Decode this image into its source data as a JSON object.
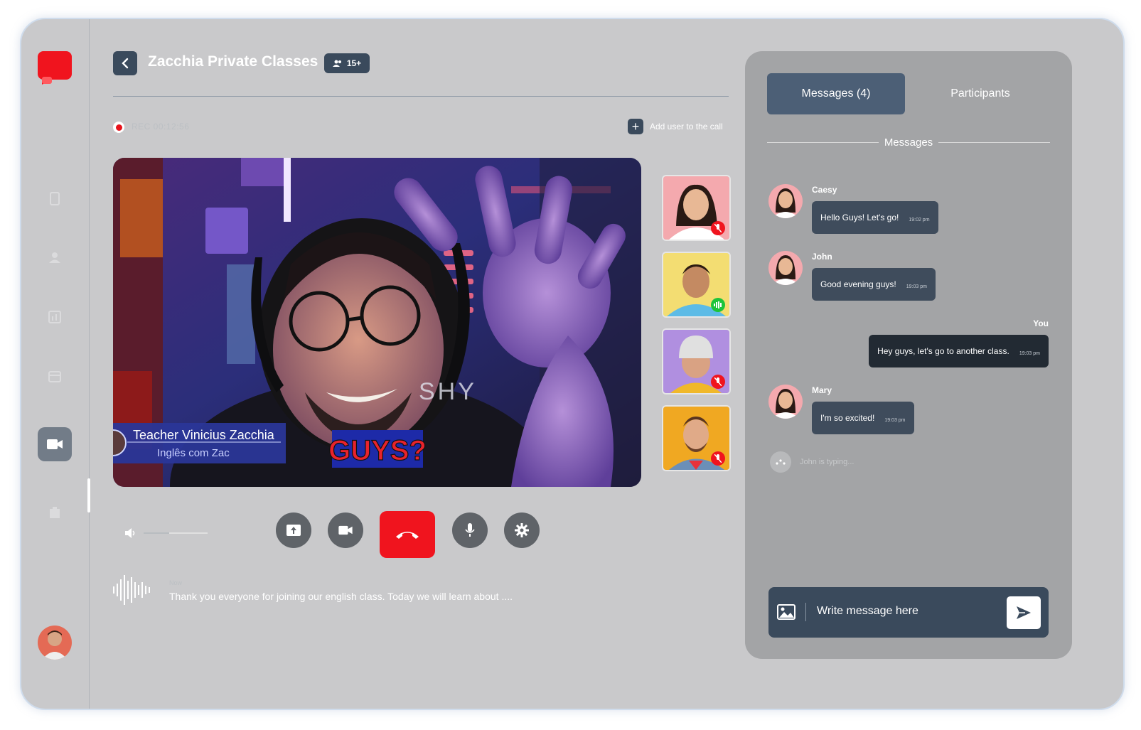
{
  "header": {
    "title": "Zacchia Private Classes",
    "participant_badge": "15+",
    "recording_text": "REC 00:12:56",
    "add_user_label": "Add user to the call"
  },
  "video": {
    "teacher_name": "Teacher Vinicius Zacchia",
    "teacher_subtitle": "Inglês com Zac",
    "on_screen_text": "GUYS?",
    "shirt_text": "SHY"
  },
  "participants_thumbs": [
    {
      "status": "muted"
    },
    {
      "status": "speaking"
    },
    {
      "status": "muted"
    },
    {
      "status": "muted"
    }
  ],
  "controls": {
    "volume_level": 0.4,
    "buttons": [
      "share-screen",
      "camera",
      "end-call",
      "microphone",
      "settings"
    ]
  },
  "caption": {
    "speaker": "Now",
    "text": "Thank you everyone for joining our english class. Today we will learn about ...."
  },
  "chat": {
    "tabs": {
      "messages": "Messages (4)",
      "participants": "Participants"
    },
    "section_title": "Messages",
    "messages": [
      {
        "author": "Caesy",
        "text": "Hello Guys! Let's go!",
        "time": "19:02 pm"
      },
      {
        "author": "John",
        "text": "Good evening guys!",
        "time": "19:03 pm"
      },
      {
        "author": "You",
        "text": "Hey guys, let's go to another class.",
        "time": "19:03 pm"
      },
      {
        "author": "Mary",
        "text": "I'm so excited!",
        "time": "19:03 pm"
      }
    ],
    "typing": "John is typing...",
    "input_placeholder": "Write message here"
  },
  "colors": {
    "frame": "#c9c9cb",
    "accent": "#3a4a5c",
    "danger": "#f0141e",
    "panel": "#a3a4a6"
  }
}
